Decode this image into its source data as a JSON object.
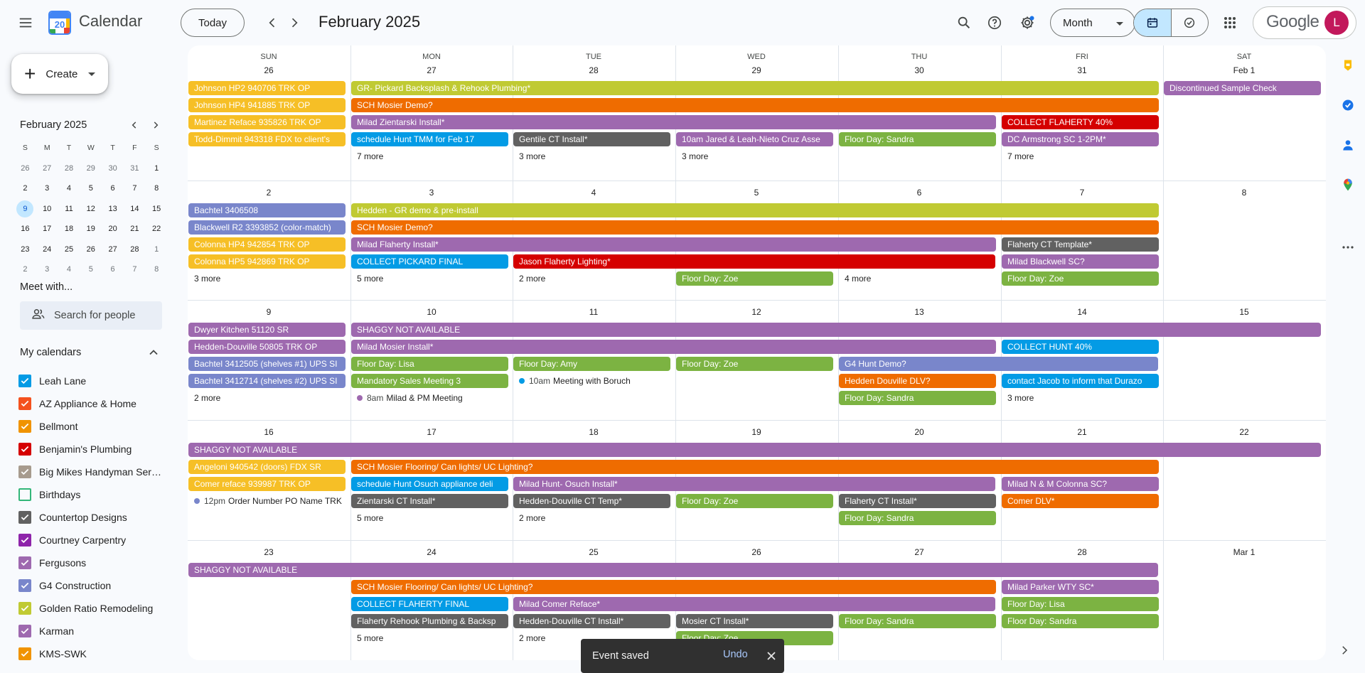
{
  "header": {
    "app_title": "Calendar",
    "logo_day": "20",
    "today_label": "Today",
    "month_title": "February 2025",
    "view_label": "Month",
    "brand": "Google",
    "avatar_initial": "L"
  },
  "sidebar": {
    "create_label": "Create",
    "mini_title": "February 2025",
    "mini_dows": [
      "S",
      "M",
      "T",
      "W",
      "T",
      "F",
      "S"
    ],
    "mini_weeks": [
      [
        "26",
        "27",
        "28",
        "29",
        "30",
        "31",
        "1"
      ],
      [
        "2",
        "3",
        "4",
        "5",
        "6",
        "7",
        "8"
      ],
      [
        "9",
        "10",
        "11",
        "12",
        "13",
        "14",
        "15"
      ],
      [
        "16",
        "17",
        "18",
        "19",
        "20",
        "21",
        "22"
      ],
      [
        "23",
        "24",
        "25",
        "26",
        "27",
        "28",
        "1"
      ],
      [
        "2",
        "3",
        "4",
        "5",
        "6",
        "7",
        "8"
      ]
    ],
    "meet_title": "Meet with...",
    "people_placeholder": "Search for people",
    "my_calendars_title": "My calendars",
    "calendars": [
      {
        "name": "Leah Lane",
        "color": "#039be5",
        "checked": true
      },
      {
        "name": "AZ Appliance & Home",
        "color": "#f4511e",
        "checked": true
      },
      {
        "name": "Bellmont",
        "color": "#f09300",
        "checked": true
      },
      {
        "name": "Benjamin's Plumbing",
        "color": "#d50000",
        "checked": true
      },
      {
        "name": "Big Mikes Handyman Serv...",
        "color": "#a79b8e",
        "checked": true
      },
      {
        "name": "Birthdays",
        "color": "#33b679",
        "checked": false
      },
      {
        "name": "Countertop Designs",
        "color": "#616161",
        "checked": true
      },
      {
        "name": "Courtney Carpentry",
        "color": "#8e24aa",
        "checked": true
      },
      {
        "name": "Fergusons",
        "color": "#9e69af",
        "checked": true
      },
      {
        "name": "G4 Construction",
        "color": "#7986cb",
        "checked": true
      },
      {
        "name": "Golden Ratio Remodeling",
        "color": "#c0ca33",
        "checked": true
      },
      {
        "name": "Karman",
        "color": "#9e69af",
        "checked": true
      },
      {
        "name": "KMS-SWK",
        "color": "#f09300",
        "checked": true
      }
    ]
  },
  "grid": {
    "dows": [
      "SUN",
      "MON",
      "TUE",
      "WED",
      "THU",
      "FRI",
      "SAT"
    ],
    "weeks": [
      {
        "days": [
          "26",
          "27",
          "28",
          "29",
          "30",
          "31",
          "Feb 1"
        ],
        "items": [
          {
            "kind": "evt",
            "col": 0,
            "span": 1,
            "lane": 0,
            "text": "Johnson HP2 940706 TRK OP",
            "color": "#f6bf26"
          },
          {
            "kind": "evt",
            "col": 1,
            "span": 5,
            "lane": 0,
            "text": "GR- Pickard Backsplash & Rehook Plumbing*",
            "color": "#c0ca33"
          },
          {
            "kind": "evt",
            "col": 6,
            "span": 1,
            "lane": 0,
            "text": "Discontinued Sample Check",
            "color": "#9e69af"
          },
          {
            "kind": "evt",
            "col": 0,
            "span": 1,
            "lane": 1,
            "text": "Johnson HP4 941885 TRK OP",
            "color": "#f6bf26"
          },
          {
            "kind": "evt",
            "col": 1,
            "span": 5,
            "lane": 1,
            "text": "SCH Mosier Demo?",
            "color": "#ef6c00"
          },
          {
            "kind": "evt",
            "col": 0,
            "span": 1,
            "lane": 2,
            "text": "Martinez Reface 935826 TRK OP",
            "color": "#f6bf26"
          },
          {
            "kind": "evt",
            "col": 1,
            "span": 4,
            "lane": 2,
            "text": "Milad Zientarski Install*",
            "color": "#9e69af"
          },
          {
            "kind": "evt",
            "col": 5,
            "span": 1,
            "lane": 2,
            "text": "COLLECT FLAHERTY 40%",
            "color": "#d50000"
          },
          {
            "kind": "evt",
            "col": 0,
            "span": 1,
            "lane": 3,
            "text": "Todd-Dimmit 943318 FDX to client's",
            "color": "#f6bf26"
          },
          {
            "kind": "evt",
            "col": 1,
            "span": 1,
            "lane": 3,
            "text": "schedule Hunt TMM for Feb 17",
            "color": "#039be5"
          },
          {
            "kind": "evt",
            "col": 2,
            "span": 1,
            "lane": 3,
            "text": "Gentile CT Install*",
            "color": "#616161"
          },
          {
            "kind": "evt",
            "col": 3,
            "span": 1,
            "lane": 3,
            "text": "10am Jared & Leah-Nieto Cruz Asse",
            "color": "#9e69af"
          },
          {
            "kind": "evt",
            "col": 4,
            "span": 1,
            "lane": 3,
            "text": "Floor Day: Sandra",
            "color": "#7cb342"
          },
          {
            "kind": "evt",
            "col": 5,
            "span": 1,
            "lane": 3,
            "text": "DC Armstrong SC 1-2PM*",
            "color": "#9e69af"
          },
          {
            "kind": "more",
            "col": 1,
            "lane": 4,
            "text": "7 more"
          },
          {
            "kind": "more",
            "col": 2,
            "lane": 4,
            "text": "3 more"
          },
          {
            "kind": "more",
            "col": 3,
            "lane": 4,
            "text": "3 more"
          },
          {
            "kind": "more",
            "col": 5,
            "lane": 4,
            "text": "7 more"
          }
        ]
      },
      {
        "days": [
          "2",
          "3",
          "4",
          "5",
          "6",
          "7",
          "8"
        ],
        "items": [
          {
            "kind": "evt",
            "col": 0,
            "span": 1,
            "lane": 0,
            "text": "Bachtel 3406508",
            "color": "#7986cb"
          },
          {
            "kind": "evt",
            "col": 1,
            "span": 5,
            "lane": 0,
            "text": "Hedden - GR demo & pre-install",
            "color": "#c0ca33"
          },
          {
            "kind": "evt",
            "col": 0,
            "span": 1,
            "lane": 1,
            "text": "Blackwell R2 3393852 (color-match)",
            "color": "#7986cb"
          },
          {
            "kind": "evt",
            "col": 1,
            "span": 5,
            "lane": 1,
            "text": "SCH Mosier Demo?",
            "color": "#ef6c00"
          },
          {
            "kind": "evt",
            "col": 0,
            "span": 1,
            "lane": 2,
            "text": "Colonna HP4 942854 TRK OP",
            "color": "#f6bf26"
          },
          {
            "kind": "evt",
            "col": 1,
            "span": 4,
            "lane": 2,
            "text": "Milad Flaherty Install*",
            "color": "#9e69af"
          },
          {
            "kind": "evt",
            "col": 5,
            "span": 1,
            "lane": 2,
            "text": "Flaherty CT Template*",
            "color": "#616161"
          },
          {
            "kind": "evt",
            "col": 0,
            "span": 1,
            "lane": 3,
            "text": "Colonna HP5 942869 TRK OP",
            "color": "#f6bf26"
          },
          {
            "kind": "evt",
            "col": 1,
            "span": 1,
            "lane": 3,
            "text": "COLLECT PICKARD FINAL",
            "color": "#039be5"
          },
          {
            "kind": "evt",
            "col": 2,
            "span": 3,
            "lane": 3,
            "text": "Jason Flaherty Lighting*",
            "color": "#d50000"
          },
          {
            "kind": "evt",
            "col": 5,
            "span": 1,
            "lane": 3,
            "text": "Milad Blackwell SC?",
            "color": "#9e69af"
          },
          {
            "kind": "more",
            "col": 0,
            "lane": 4,
            "text": "3 more"
          },
          {
            "kind": "more",
            "col": 1,
            "lane": 4,
            "text": "5 more"
          },
          {
            "kind": "more",
            "col": 2,
            "lane": 4,
            "text": "2 more"
          },
          {
            "kind": "evt",
            "col": 3,
            "span": 1,
            "lane": 4,
            "text": "Floor Day: Zoe",
            "color": "#7cb342"
          },
          {
            "kind": "more",
            "col": 4,
            "lane": 4,
            "text": "4 more"
          },
          {
            "kind": "evt",
            "col": 5,
            "span": 1,
            "lane": 4,
            "text": "Floor Day: Zoe",
            "color": "#7cb342"
          }
        ]
      },
      {
        "days": [
          "9",
          "10",
          "11",
          "12",
          "13",
          "14",
          "15"
        ],
        "items": [
          {
            "kind": "evt",
            "col": 0,
            "span": 1,
            "lane": 0,
            "text": "Dwyer Kitchen 51120 SR",
            "color": "#9e69af"
          },
          {
            "kind": "evt",
            "col": 1,
            "span": 6,
            "lane": 0,
            "text": "SHAGGY NOT AVAILABLE",
            "color": "#9e69af"
          },
          {
            "kind": "evt",
            "col": 0,
            "span": 1,
            "lane": 1,
            "text": "Hedden-Douville 50805 TRK OP",
            "color": "#9e69af"
          },
          {
            "kind": "evt",
            "col": 1,
            "span": 4,
            "lane": 1,
            "text": "Milad Mosier Install*",
            "color": "#9e69af"
          },
          {
            "kind": "evt",
            "col": 5,
            "span": 1,
            "lane": 1,
            "text": "COLLECT HUNT 40%",
            "color": "#039be5"
          },
          {
            "kind": "evt",
            "col": 0,
            "span": 1,
            "lane": 2,
            "text": "Bachtel 3412505 (shelves #1) UPS SI",
            "color": "#7986cb"
          },
          {
            "kind": "evt",
            "col": 1,
            "span": 1,
            "lane": 2,
            "text": "Floor Day: Lisa",
            "color": "#7cb342"
          },
          {
            "kind": "evt",
            "col": 2,
            "span": 1,
            "lane": 2,
            "text": "Floor Day: Amy",
            "color": "#7cb342"
          },
          {
            "kind": "evt",
            "col": 3,
            "span": 1,
            "lane": 2,
            "text": "Floor Day: Zoe",
            "color": "#7cb342"
          },
          {
            "kind": "evt",
            "col": 4,
            "span": 2,
            "lane": 2,
            "text": "G4 Hunt Demo?",
            "color": "#7986cb"
          },
          {
            "kind": "evt",
            "col": 0,
            "span": 1,
            "lane": 3,
            "text": "Bachtel 3412714 (shelves #2) UPS SI",
            "color": "#7986cb"
          },
          {
            "kind": "evt",
            "col": 1,
            "span": 1,
            "lane": 3,
            "text": "Mandatory Sales Meeting 3",
            "color": "#7cb342"
          },
          {
            "kind": "timed",
            "col": 2,
            "lane": 3,
            "time": "10am",
            "text": "Meeting with Boruch",
            "color": "#039be5"
          },
          {
            "kind": "evt",
            "col": 4,
            "span": 1,
            "lane": 3,
            "text": "Hedden Douville DLV?",
            "color": "#ef6c00"
          },
          {
            "kind": "evt",
            "col": 5,
            "span": 1,
            "lane": 3,
            "text": "contact Jacob to inform that Durazo",
            "color": "#039be5"
          },
          {
            "kind": "more",
            "col": 0,
            "lane": 4,
            "text": "2 more"
          },
          {
            "kind": "timed",
            "col": 1,
            "lane": 4,
            "time": "8am",
            "text": "Milad & PM Meeting",
            "color": "#9e69af"
          },
          {
            "kind": "evt",
            "col": 4,
            "span": 1,
            "lane": 4,
            "text": "Floor Day: Sandra",
            "color": "#7cb342"
          },
          {
            "kind": "more",
            "col": 5,
            "lane": 4,
            "text": "3 more"
          }
        ]
      },
      {
        "days": [
          "16",
          "17",
          "18",
          "19",
          "20",
          "21",
          "22"
        ],
        "items": [
          {
            "kind": "evt",
            "col": 0,
            "span": 7,
            "lane": 0,
            "text": "SHAGGY NOT AVAILABLE",
            "color": "#9e69af"
          },
          {
            "kind": "evt",
            "col": 0,
            "span": 1,
            "lane": 1,
            "text": "Angeloni 940542 (doors) FDX SR",
            "color": "#f6bf26"
          },
          {
            "kind": "evt",
            "col": 1,
            "span": 5,
            "lane": 1,
            "text": "SCH Mosier Flooring/ Can lights/ UC Lighting?",
            "color": "#ef6c00"
          },
          {
            "kind": "evt",
            "col": 0,
            "span": 1,
            "lane": 2,
            "text": "Comer reface 939987 TRK OP",
            "color": "#f6bf26"
          },
          {
            "kind": "evt",
            "col": 1,
            "span": 1,
            "lane": 2,
            "text": "schedule Hunt Osuch appliance deli",
            "color": "#039be5"
          },
          {
            "kind": "evt",
            "col": 2,
            "span": 3,
            "lane": 2,
            "text": "Milad Hunt- Osuch Install*",
            "color": "#9e69af"
          },
          {
            "kind": "evt",
            "col": 5,
            "span": 1,
            "lane": 2,
            "text": "Milad N & M Colonna SC?",
            "color": "#9e69af"
          },
          {
            "kind": "timed",
            "col": 0,
            "lane": 3,
            "time": "12pm",
            "text": "Order Number PO Name TRK",
            "color": "#7986cb"
          },
          {
            "kind": "evt",
            "col": 1,
            "span": 1,
            "lane": 3,
            "text": "Zientarski CT Install*",
            "color": "#616161"
          },
          {
            "kind": "evt",
            "col": 2,
            "span": 1,
            "lane": 3,
            "text": "Hedden-Douville CT Temp*",
            "color": "#616161"
          },
          {
            "kind": "evt",
            "col": 3,
            "span": 1,
            "lane": 3,
            "text": "Floor Day: Zoe",
            "color": "#7cb342"
          },
          {
            "kind": "evt",
            "col": 4,
            "span": 1,
            "lane": 3,
            "text": "Flaherty CT Install*",
            "color": "#616161"
          },
          {
            "kind": "evt",
            "col": 5,
            "span": 1,
            "lane": 3,
            "text": "Comer DLV*",
            "color": "#ef6c00"
          },
          {
            "kind": "more",
            "col": 1,
            "lane": 4,
            "text": "5 more"
          },
          {
            "kind": "more",
            "col": 2,
            "lane": 4,
            "text": "2 more"
          },
          {
            "kind": "evt",
            "col": 4,
            "span": 1,
            "lane": 4,
            "text": "Floor Day: Sandra",
            "color": "#7cb342"
          }
        ]
      },
      {
        "days": [
          "23",
          "24",
          "25",
          "26",
          "27",
          "28",
          "Mar 1"
        ],
        "items": [
          {
            "kind": "evt",
            "col": 0,
            "span": 6,
            "lane": 0,
            "text": "SHAGGY NOT AVAILABLE",
            "color": "#9e69af"
          },
          {
            "kind": "evt",
            "col": 1,
            "span": 4,
            "lane": 1,
            "text": "SCH Mosier Flooring/ Can lights/ UC Lighting?",
            "color": "#ef6c00"
          },
          {
            "kind": "evt",
            "col": 5,
            "span": 1,
            "lane": 1,
            "text": "Milad Parker WTY SC*",
            "color": "#9e69af"
          },
          {
            "kind": "evt",
            "col": 1,
            "span": 1,
            "lane": 2,
            "text": "COLLECT FLAHERTY FINAL",
            "color": "#039be5"
          },
          {
            "kind": "evt",
            "col": 2,
            "span": 3,
            "lane": 2,
            "text": "Milad Comer Reface*",
            "color": "#9e69af"
          },
          {
            "kind": "evt",
            "col": 5,
            "span": 1,
            "lane": 2,
            "text": "Floor Day: Lisa",
            "color": "#7cb342"
          },
          {
            "kind": "evt",
            "col": 1,
            "span": 1,
            "lane": 3,
            "text": "Flaherty Rehook Plumbing & Backsp",
            "color": "#616161"
          },
          {
            "kind": "evt",
            "col": 2,
            "span": 1,
            "lane": 3,
            "text": "Hedden-Douville CT Install*",
            "color": "#616161"
          },
          {
            "kind": "evt",
            "col": 3,
            "span": 1,
            "lane": 3,
            "text": "Mosier CT Install*",
            "color": "#616161"
          },
          {
            "kind": "evt",
            "col": 4,
            "span": 1,
            "lane": 3,
            "text": "Floor Day: Sandra",
            "color": "#7cb342"
          },
          {
            "kind": "evt",
            "col": 5,
            "span": 1,
            "lane": 3,
            "text": "Floor Day: Sandra",
            "color": "#7cb342"
          },
          {
            "kind": "more",
            "col": 1,
            "lane": 4,
            "text": "5 more"
          },
          {
            "kind": "more",
            "col": 2,
            "lane": 4,
            "text": "2 more"
          },
          {
            "kind": "evt",
            "col": 3,
            "span": 1,
            "lane": 4,
            "text": "Floor Day: Zoe",
            "color": "#7cb342"
          }
        ]
      }
    ]
  },
  "toast": {
    "message": "Event saved",
    "undo_label": "Undo"
  }
}
